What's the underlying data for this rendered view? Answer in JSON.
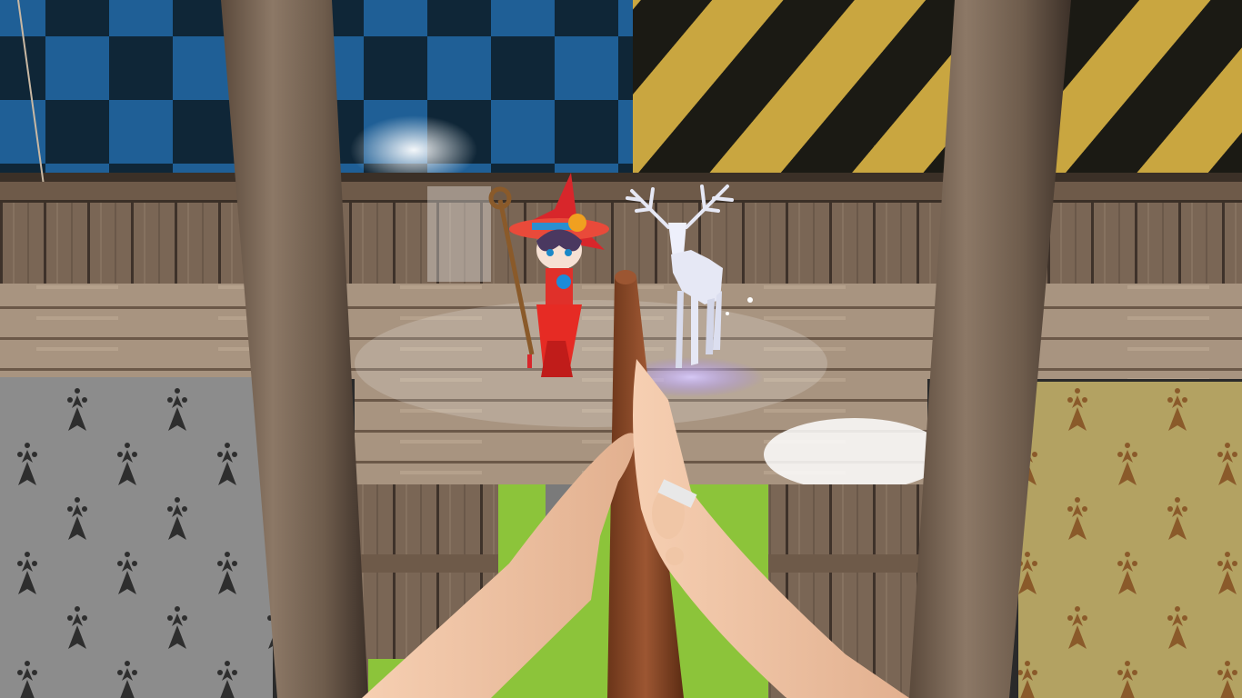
{
  "scene": {
    "view": "first-person",
    "colors": {
      "banner_blue": "#1f5f96",
      "banner_dark": "#0e2233",
      "banner_yellow": "#c9a640",
      "banner_black": "#1b1a14",
      "wood_light": "#9a8570",
      "wood_dark": "#5e4c3d",
      "grass": "#8cc43a",
      "skin": "#f2c5a4",
      "wand": "#8a4a28",
      "witch_red": "#d8262b",
      "stag_white": "#e6e8f5",
      "glow_purple": "#b9a8ff"
    }
  },
  "characters": {
    "witch": {
      "icon": "witch-icon"
    },
    "stag": {
      "icon": "stag-icon"
    }
  },
  "player": {
    "held_item": "wand-icon",
    "hands": "hands-icon"
  }
}
